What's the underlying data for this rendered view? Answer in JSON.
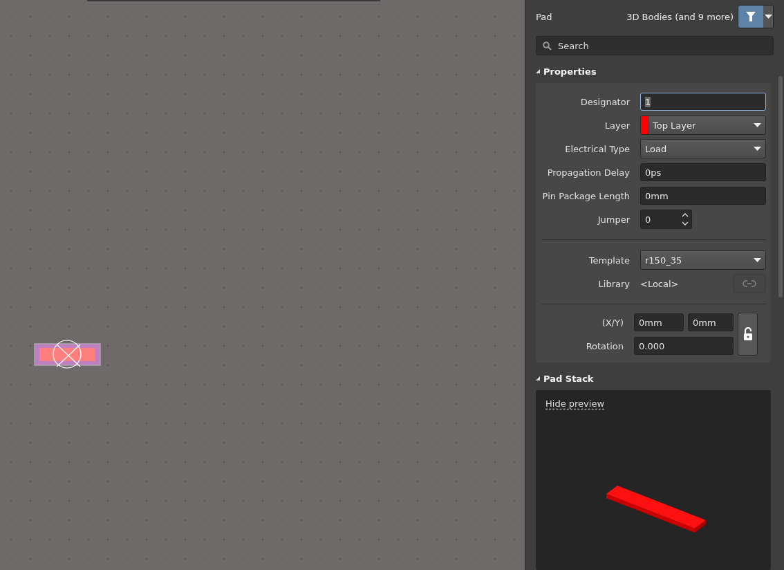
{
  "panel": {
    "object_type": "Pad",
    "filter_summary": "3D Bodies (and 9 more)",
    "search": {
      "placeholder": "Search"
    },
    "properties": {
      "title": "Properties",
      "expanded": true,
      "rows": [
        {
          "kind": "text_input",
          "label": "Designator",
          "value": "1",
          "focused": true
        },
        {
          "kind": "dropdown",
          "label": "Layer",
          "value": "Top Layer",
          "color": "#ff0000"
        },
        {
          "kind": "dropdown",
          "label": "Electrical Type",
          "value": "Load"
        },
        {
          "kind": "text_input",
          "label": "Propagation Delay",
          "value": "0ps",
          "focused": false
        },
        {
          "kind": "text_input",
          "label": "Pin Package Length",
          "value": "0mm",
          "focused": false
        },
        {
          "kind": "spinner",
          "label": "Jumper",
          "value": "0"
        },
        {
          "kind": "divider"
        },
        {
          "kind": "dropdown",
          "label": "Template",
          "value": "r150_35"
        },
        {
          "kind": "library",
          "label": "Library",
          "value": "<Local>"
        },
        {
          "kind": "divider"
        },
        {
          "kind": "position",
          "label": "(X/Y)",
          "x": "0mm",
          "y": "0mm",
          "rotation_label": "Rotation",
          "rotation": "0.000",
          "locked": false
        }
      ]
    },
    "pad_stack": {
      "title": "Pad Stack",
      "expanded": true,
      "preview_link": "Hide preview"
    }
  }
}
